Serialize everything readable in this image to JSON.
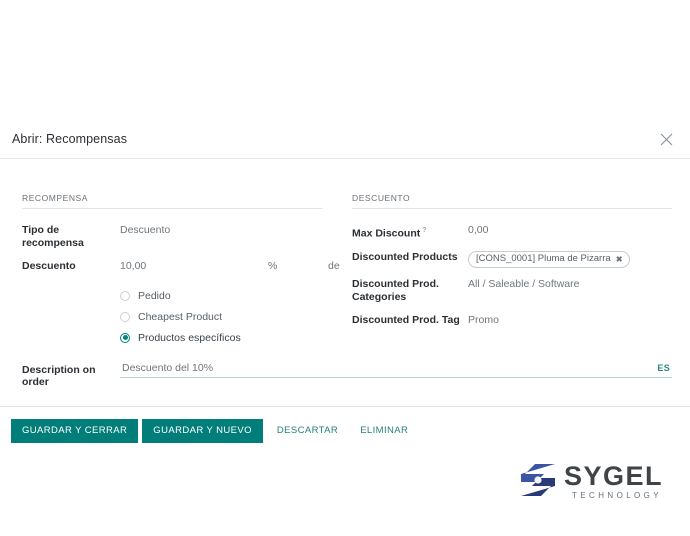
{
  "dialog": {
    "title": "Abrir: Recompensas",
    "close_icon": "close-icon"
  },
  "sections": {
    "left": {
      "title": "RECOMPENSA",
      "fields": [
        {
          "label": "Tipo de recompensa",
          "value": "Descuento"
        },
        {
          "label": "Descuento",
          "value": "10,00",
          "unit_pct": "%",
          "unit_of": "de"
        }
      ],
      "radio_group": {
        "options": [
          {
            "label": "Pedido",
            "selected": false
          },
          {
            "label": "Cheapest Product",
            "selected": false
          },
          {
            "label": "Productos específicos",
            "selected": true
          }
        ]
      }
    },
    "right": {
      "title": "DESCUENTO",
      "fields": [
        {
          "label": "Max Discount",
          "help": "?",
          "value": "0,00"
        },
        {
          "label": "Discounted Products",
          "chip": "[CONS_0001] Pluma de Pizarra",
          "chip_remove": "✖"
        },
        {
          "label": "Discounted Prod. Categories",
          "value": "All / Saleable / Software"
        },
        {
          "label": "Discounted Prod. Tag",
          "value": "Promo"
        }
      ]
    }
  },
  "description": {
    "label": "Description on order",
    "value": "Descuento del 10%",
    "lang": "ES"
  },
  "footer": {
    "buttons": [
      {
        "label": "GUARDAR Y CERRAR",
        "style": "primary"
      },
      {
        "label": "GUARDAR Y NUEVO",
        "style": "primary"
      },
      {
        "label": "DESCARTAR",
        "style": "link"
      },
      {
        "label": "ELIMINAR",
        "style": "link"
      }
    ]
  },
  "logo": {
    "word": "SYGEL",
    "sub": "TECHNOLOGY"
  },
  "colors": {
    "accent": "#017e79",
    "link": "#27807c",
    "logo_blue": "#3b55a4",
    "logo_navy": "#2a3a78",
    "text": "#2b2f33"
  }
}
